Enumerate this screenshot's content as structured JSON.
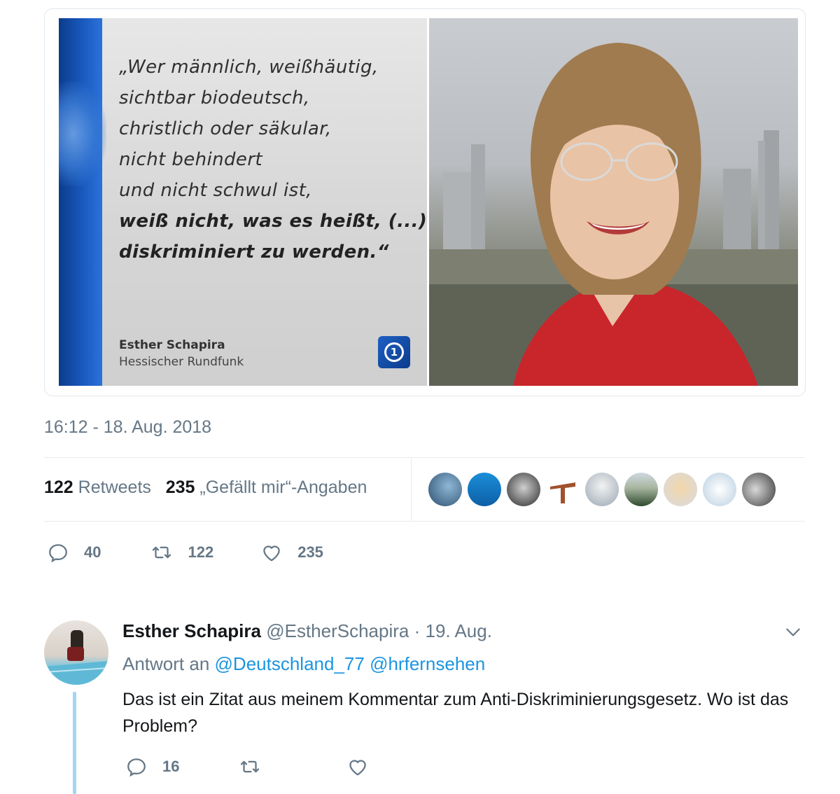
{
  "tweet": {
    "quote_card": {
      "lines": [
        "„Wer männlich, weißhäutig,",
        "sichtbar biodeutsch,",
        "christlich oder säkular,",
        "nicht behindert",
        "und nicht schwul ist,",
        "weiß nicht, was es heißt, (...)",
        "diskriminiert zu werden.“"
      ],
      "bold_from_line": 5,
      "author": "Esther Schapira",
      "organization": "Hessischer Rundfunk",
      "logo_text": "1"
    },
    "timestamp": "16:12 - 18. Aug. 2018",
    "retweets_count": "122",
    "retweets_label": "Retweets",
    "likes_count": "235",
    "likes_label": "„Gefällt mir“-Angaben",
    "liker_avatars": [
      "avatar-1",
      "avatar-2",
      "avatar-3",
      "avatar-4",
      "avatar-5",
      "avatar-6",
      "avatar-7",
      "avatar-8",
      "avatar-9"
    ],
    "actions": {
      "reply_count": "40",
      "retweet_count": "122",
      "like_count": "235"
    }
  },
  "reply": {
    "name": "Esther Schapira",
    "handle": "@EstherSchapira",
    "separator": "·",
    "date": "19. Aug.",
    "replying_to_label": "Antwort an",
    "mention_1": "@Deutschland_77",
    "mention_2": "@hrfernsehen",
    "text": "Das ist ein Zitat aus meinem Kommentar zum Anti-Diskriminierungsgesetz. Wo ist das Problem?",
    "actions": {
      "reply_count": "16"
    }
  },
  "colors": {
    "link": "#1b95e0",
    "muted": "#657786",
    "text": "#14171a",
    "thread_line": "#a3d6f5"
  }
}
